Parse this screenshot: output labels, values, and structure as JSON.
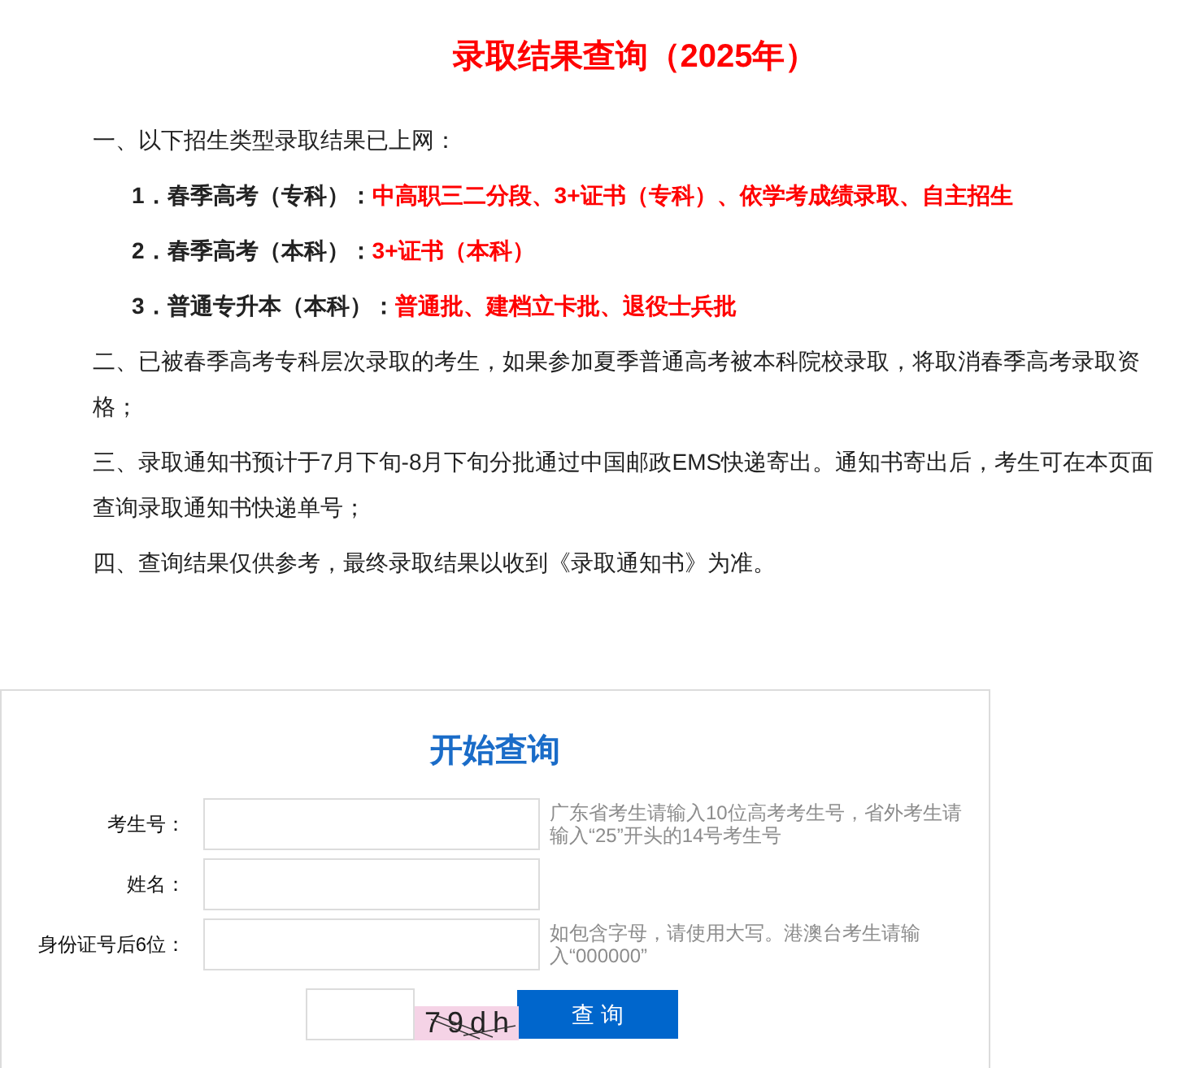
{
  "title": "录取结果查询（2025年）",
  "notices": [
    {
      "kind": "heading",
      "text": "一、以下招生类型录取结果已上网："
    },
    {
      "kind": "item",
      "label": "1．春季高考（专科）：",
      "value": "中高职三二分段、3+证书（专科）、依学考成绩录取、自主招生"
    },
    {
      "kind": "item",
      "label": "2．春季高考（本科）：",
      "value": "3+证书（本科）"
    },
    {
      "kind": "item",
      "label": "3．普通专升本（本科）：",
      "value": "普通批、建档立卡批、退役士兵批"
    },
    {
      "kind": "paragraph",
      "text": "二、已被春季高考专科层次录取的考生，如果参加夏季普通高考被本科院校录取，将取消春季高考录取资格；"
    },
    {
      "kind": "paragraph",
      "text": "三、录取通知书预计于7月下旬-8月下旬分批通过中国邮政EMS快递寄出。通知书寄出后，考生可在本页面查询录取通知书快递单号；"
    },
    {
      "kind": "paragraph",
      "text": "四、查询结果仅供参考，最终录取结果以收到《录取通知书》为准。"
    }
  ],
  "form": {
    "title": "开始查询",
    "fields": [
      {
        "label": "考生号：",
        "hint": "广东省考生请输入10位高考考生号，省外考生请输入“25”开头的14号考生号"
      },
      {
        "label": "姓名："
      },
      {
        "label": "身份证号后6位：",
        "hint": "如包含字母，请使用大写。港澳台考生请输入“000000”"
      }
    ],
    "captcha": "79dh",
    "submit": "查 询"
  }
}
